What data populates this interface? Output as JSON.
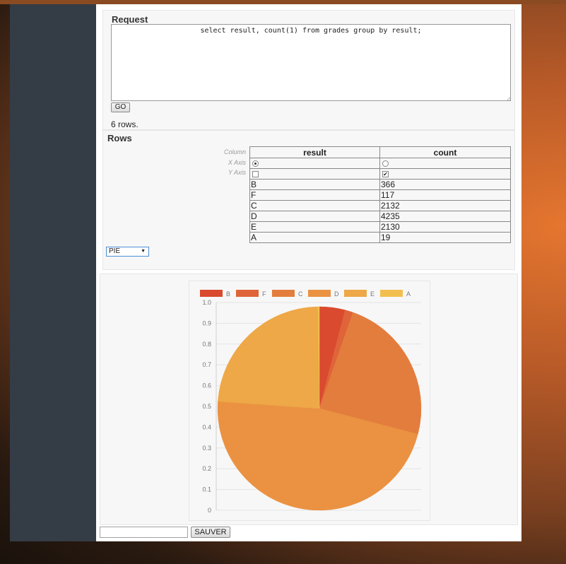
{
  "request": {
    "title": "Request",
    "query": "select result, count(1) from grades group by result;",
    "go_label": "GO",
    "row_count_text": "6 rows."
  },
  "rows": {
    "title": "Rows",
    "labels": {
      "column": "Column",
      "x_axis": "X Axis",
      "y_axis": "Y Axis"
    },
    "columns": [
      "result",
      "count"
    ],
    "x_axis_selected": "result",
    "y_axis_checked": [
      "count"
    ],
    "data": [
      [
        "B",
        "366"
      ],
      [
        "F",
        "117"
      ],
      [
        "C",
        "2132"
      ],
      [
        "D",
        "4235"
      ],
      [
        "E",
        "2130"
      ],
      [
        "A",
        "19"
      ]
    ]
  },
  "chart_type_select": "PIE",
  "chart_data": {
    "type": "pie",
    "categories": [
      "B",
      "F",
      "C",
      "D",
      "E",
      "A"
    ],
    "values": [
      366,
      117,
      2132,
      4235,
      2130,
      19
    ],
    "colors": [
      "#d94a2e",
      "#e0643a",
      "#e37d3d",
      "#ea9242",
      "#eea847",
      "#f2bf4e"
    ],
    "y_ticks": [
      "1.0",
      "0.9",
      "0.8",
      "0.7",
      "0.6",
      "0.5",
      "0.4",
      "0.3",
      "0.2",
      "0.1",
      "0"
    ],
    "legend_position": "top"
  },
  "save": {
    "input_value": "",
    "button_label": "SAUVER"
  }
}
